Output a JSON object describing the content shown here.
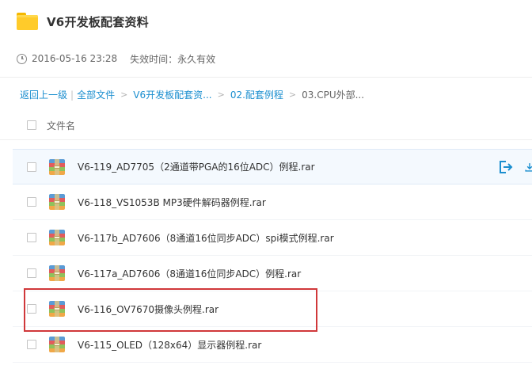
{
  "header": {
    "title": "V6开发板配套资料",
    "folder_icon": "folder-icon"
  },
  "meta": {
    "date": "2016-05-16 23:28",
    "expire": "失效时间：永久有效"
  },
  "breadcrumb": {
    "back": "返回上一级",
    "sep": "|",
    "all_files": "全部文件",
    "arrow": ">",
    "level1": "V6开发板配套资...",
    "level2": "02.配套例程",
    "current": "03.CPU外部..."
  },
  "list": {
    "column_name": "文件名",
    "rows": [
      {
        "name": "V6-119_AD7705（2通道带PGA的16位ADC）例程.rar",
        "icon": "rar-archive-icon"
      },
      {
        "name": "V6-118_VS1053B MP3硬件解码器例程.rar",
        "icon": "rar-archive-icon"
      },
      {
        "name": "V6-117b_AD7606（8通道16位同步ADC）spi模式例程.rar",
        "icon": "rar-archive-icon"
      },
      {
        "name": "V6-117a_AD7606（8通道16位同步ADC）例程.rar",
        "icon": "rar-archive-icon"
      },
      {
        "name": "V6-116_OV7670摄像头例程.rar",
        "icon": "rar-archive-icon"
      },
      {
        "name": "V6-115_OLED（128x64）显示器例程.rar",
        "icon": "rar-archive-icon"
      }
    ]
  },
  "colors": {
    "link": "#1a8ecf",
    "highlight_border": "#d0383a",
    "hover_row": "#f4f9fe",
    "action_icon": "#1a8ecf"
  }
}
